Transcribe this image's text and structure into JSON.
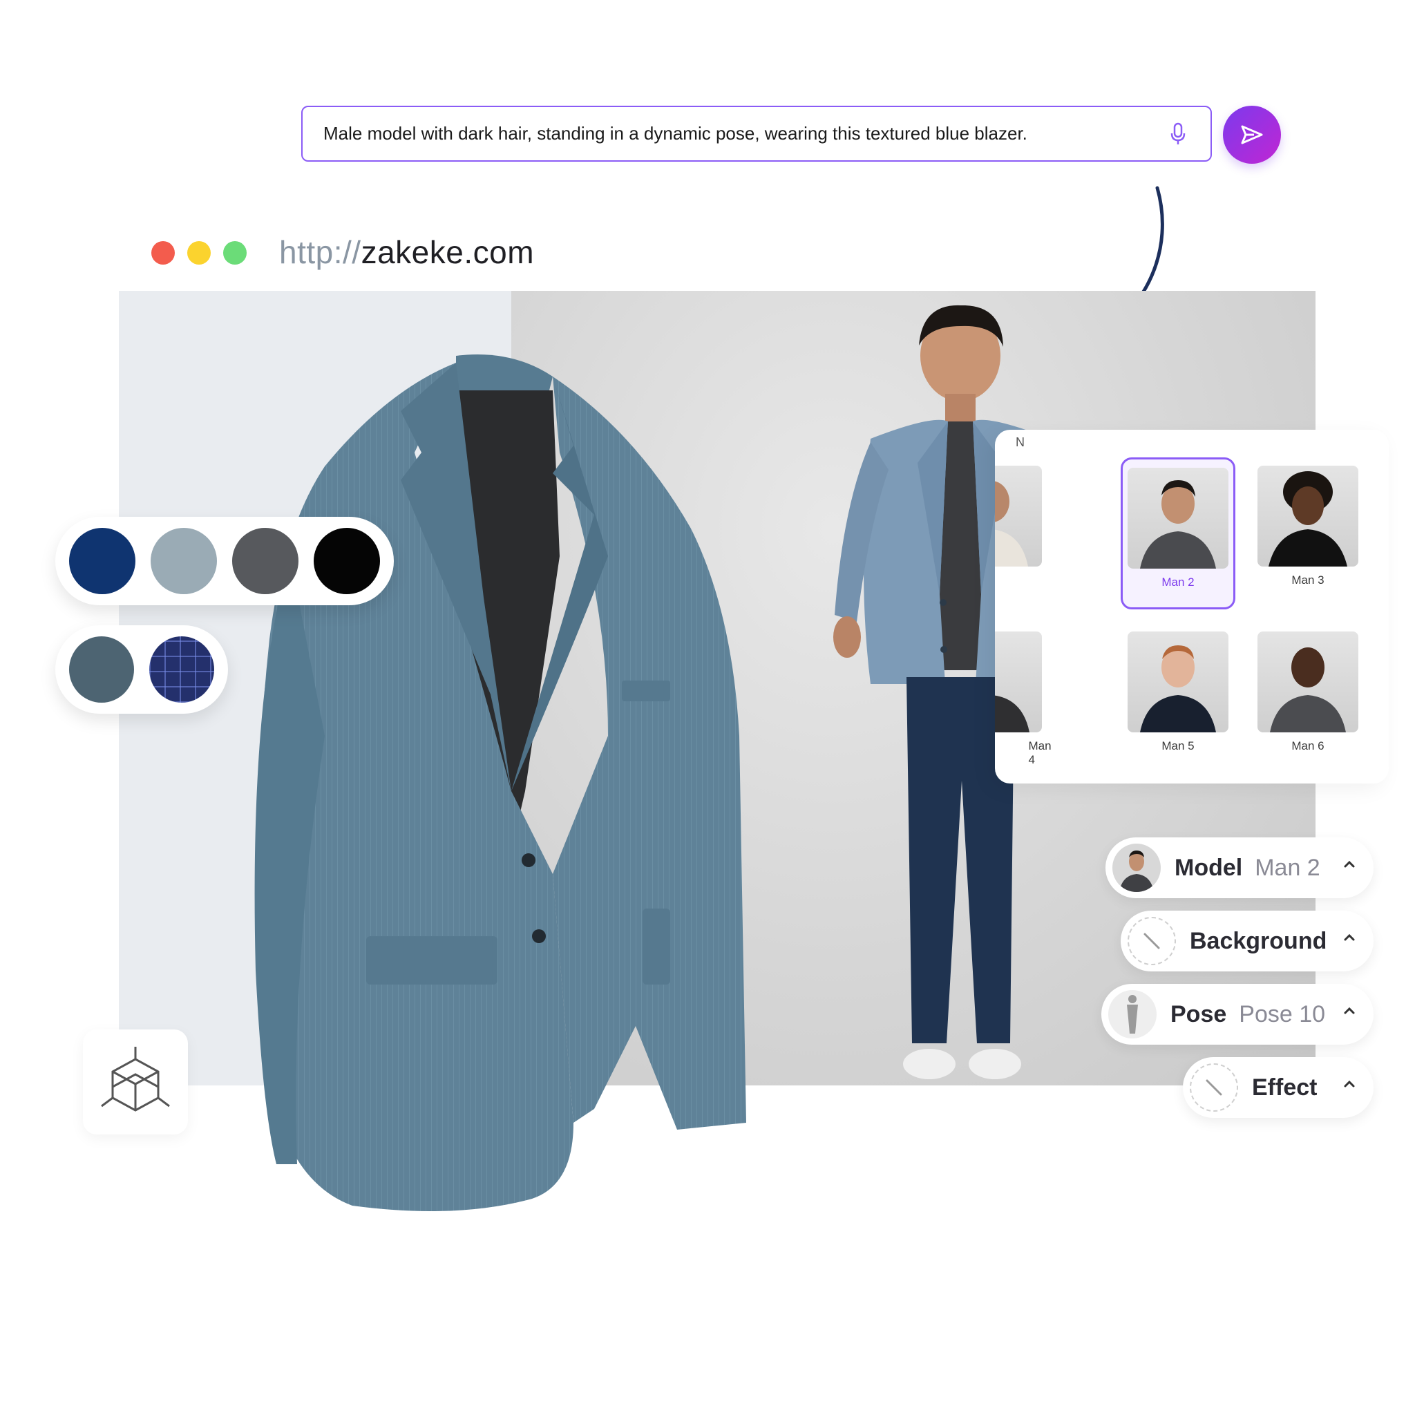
{
  "prompt": {
    "text": "Male model with dark hair, standing in a dynamic pose, wearing this textured blue blazer.",
    "mic_icon": "microphone-icon",
    "send_icon": "send-icon",
    "accent": "#8b5cf6"
  },
  "browser": {
    "url_scheme": "http://",
    "url_host": "zakeke.com"
  },
  "swatches": {
    "row1": [
      {
        "name": "navy",
        "color": "#0f3470"
      },
      {
        "name": "light-blue-grey",
        "color": "#9aabb5"
      },
      {
        "name": "charcoal",
        "color": "#57595d"
      },
      {
        "name": "black",
        "color": "#050505"
      }
    ],
    "row2": [
      {
        "name": "slate-texture",
        "color": "#4d6472"
      },
      {
        "name": "navy-check",
        "color": "#24306c"
      }
    ]
  },
  "model_picker": {
    "header_stub": "N",
    "models": [
      {
        "label": "",
        "selected": false
      },
      {
        "label": "Man 2",
        "selected": true
      },
      {
        "label": "Man 3",
        "selected": false
      },
      {
        "label": "Man 4",
        "selected": false
      },
      {
        "label": "Man 5",
        "selected": false
      },
      {
        "label": "Man 6",
        "selected": false
      }
    ]
  },
  "options": {
    "model": {
      "label": "Model",
      "value": "Man 2"
    },
    "background": {
      "label": "Background"
    },
    "pose": {
      "label": "Pose",
      "value": "Pose 10"
    },
    "effect": {
      "label": "Effect"
    }
  }
}
